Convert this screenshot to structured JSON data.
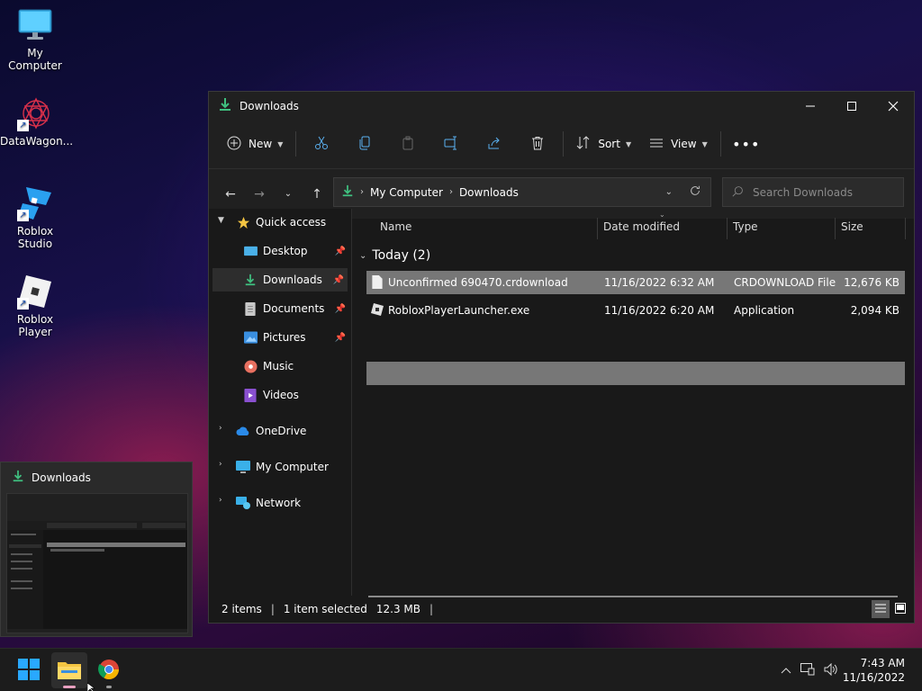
{
  "desktop": {
    "icons": [
      {
        "label": "My Computer"
      },
      {
        "label": "DataWagon..."
      },
      {
        "label": "Roblox Studio"
      },
      {
        "label": "Roblox Player"
      }
    ]
  },
  "window": {
    "title": "Downloads",
    "toolbar": {
      "new_label": "New",
      "sort_label": "Sort",
      "view_label": "View"
    },
    "address": {
      "crumbs": [
        "My Computer",
        "Downloads"
      ]
    },
    "search": {
      "placeholder": "Search Downloads"
    },
    "navpane": {
      "quick_access": "Quick access",
      "items": [
        {
          "label": "Desktop"
        },
        {
          "label": "Downloads"
        },
        {
          "label": "Documents"
        },
        {
          "label": "Pictures"
        },
        {
          "label": "Music"
        },
        {
          "label": "Videos"
        }
      ],
      "roots": [
        {
          "label": "OneDrive"
        },
        {
          "label": "My Computer"
        },
        {
          "label": "Network"
        }
      ]
    },
    "columns": {
      "name": "Name",
      "date": "Date modified",
      "type": "Type",
      "size": "Size"
    },
    "group": "Today (2)",
    "files": [
      {
        "name": "Unconfirmed 690470.crdownload",
        "date": "11/16/2022 6:32 AM",
        "type": "CRDOWNLOAD File",
        "size": "12,676 KB"
      },
      {
        "name": "RobloxPlayerLauncher.exe",
        "date": "11/16/2022 6:20 AM",
        "type": "Application",
        "size": "2,094 KB"
      }
    ],
    "status": {
      "items": "2 items",
      "selected": "1 item selected",
      "size": "12.3 MB"
    }
  },
  "preview": {
    "title": "Downloads"
  },
  "taskbar": {
    "time": "7:43 AM",
    "date": "11/16/2022"
  },
  "colors": {
    "accent_green": "#3fbf7f",
    "folder_yellow": "#f4c542",
    "win_blue": "#29a8ff"
  }
}
